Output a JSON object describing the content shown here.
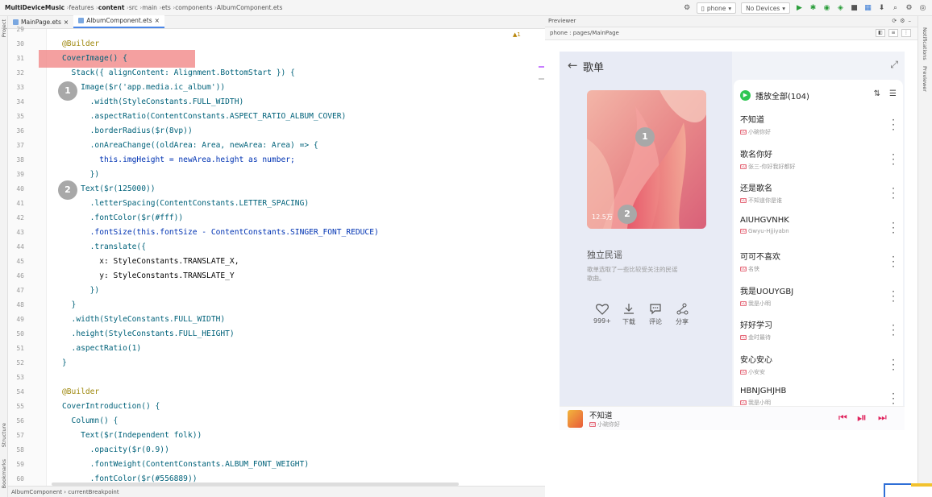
{
  "breadcrumb": [
    "MultiDeviceMusic",
    "features",
    "content",
    "src",
    "main",
    "ets",
    "components",
    "AlbumComponent.ets"
  ],
  "toolbar": {
    "device": "phone",
    "no_devices": "No Devices"
  },
  "tabs": [
    {
      "label": "MainPage.ets",
      "active": false
    },
    {
      "label": "AlbumComponent.ets",
      "active": true
    }
  ],
  "left_strip": {
    "project": "Project",
    "structure": "Structure",
    "bookmarks": "Bookmarks"
  },
  "editor": {
    "warnings": "▲1",
    "lines": [
      {
        "n": "29",
        "text": ""
      },
      {
        "n": "30",
        "text": "@Builder"
      },
      {
        "n": "31",
        "text": "CoverImage() {"
      },
      {
        "n": "32",
        "text": "  Stack({ alignContent: Alignment.BottomStart }) {"
      },
      {
        "n": "33",
        "text": "    Image($r('app.media.ic_album'))"
      },
      {
        "n": "34",
        "text": "      .width(StyleConstants.FULL_WIDTH)"
      },
      {
        "n": "35",
        "text": "      .aspectRatio(ContentConstants.ASPECT_RATIO_ALBUM_COVER)"
      },
      {
        "n": "36",
        "text": "      .borderRadius($r(8vp))"
      },
      {
        "n": "37",
        "text": "      .onAreaChange((oldArea: Area, newArea: Area) => {"
      },
      {
        "n": "38",
        "text": "        this.imgHeight = newArea.height as number;"
      },
      {
        "n": "39",
        "text": "      })"
      },
      {
        "n": "40",
        "text": "    Text($r(125000))"
      },
      {
        "n": "41",
        "text": "      .letterSpacing(ContentConstants.LETTER_SPACING)"
      },
      {
        "n": "42",
        "text": "      .fontColor($r(#fff))"
      },
      {
        "n": "43",
        "text": "      .fontSize(this.fontSize - ContentConstants.SINGER_FONT_REDUCE)"
      },
      {
        "n": "44",
        "text": "      .translate({"
      },
      {
        "n": "45",
        "text": "        x: StyleConstants.TRANSLATE_X,"
      },
      {
        "n": "46",
        "text": "        y: StyleConstants.TRANSLATE_Y"
      },
      {
        "n": "47",
        "text": "      })"
      },
      {
        "n": "48",
        "text": "  }"
      },
      {
        "n": "49",
        "text": "  .width(StyleConstants.FULL_WIDTH)"
      },
      {
        "n": "50",
        "text": "  .height(StyleConstants.FULL_HEIGHT)"
      },
      {
        "n": "51",
        "text": "  .aspectRatio(1)"
      },
      {
        "n": "52",
        "text": "}"
      },
      {
        "n": "53",
        "text": ""
      },
      {
        "n": "54",
        "text": "@Builder"
      },
      {
        "n": "55",
        "text": "CoverIntroduction() {"
      },
      {
        "n": "56",
        "text": "  Column() {"
      },
      {
        "n": "57",
        "text": "    Text($r(Independent folk))"
      },
      {
        "n": "58",
        "text": "      .opacity($r(0.9))"
      },
      {
        "n": "59",
        "text": "      .fontWeight(ContentConstants.ALBUM_FONT_WEIGHT)"
      },
      {
        "n": "60",
        "text": "      .fontColor($r(#556889))"
      }
    ],
    "badges": [
      "1",
      "2"
    ]
  },
  "statusbar": {
    "path": "AlbumComponent › currentBreakpoint"
  },
  "previewer": {
    "title": "Previewer",
    "path": "phone : pages/MainPage"
  },
  "right_strip": {
    "notifications": "Notifications",
    "previewer": "Previewer"
  },
  "app": {
    "title": "歌单",
    "play_count": "12.5万",
    "album_name": "独立民谣",
    "album_desc": "歌单选取了一些比较受关注的民谣歌曲。",
    "badges": [
      "1",
      "2"
    ],
    "actions": [
      {
        "label": "999+",
        "icon": "heart-icon"
      },
      {
        "label": "下载",
        "icon": "download-icon"
      },
      {
        "label": "评论",
        "icon": "comment-icon"
      },
      {
        "label": "分享",
        "icon": "share-icon"
      }
    ],
    "play_all": "播放全部(104)",
    "songs": [
      {
        "title": "不知道",
        "singer": "小碗你好"
      },
      {
        "title": "歌名你好",
        "singer": "张三-你好我好都好"
      },
      {
        "title": "还是歌名",
        "singer": "不知道你是谁"
      },
      {
        "title": "AIUHGVNHK",
        "singer": "Gwyu-Hjjiyabn"
      },
      {
        "title": "可可不喜欢",
        "singer": "名侠"
      },
      {
        "title": "我是UOUYGBJ",
        "singer": "我是小明"
      },
      {
        "title": "好好学习",
        "singer": "金时最待"
      },
      {
        "title": "安心安心",
        "singer": "小安安"
      },
      {
        "title": "HBNJGHJHB",
        "singer": "我是小明"
      }
    ],
    "player": {
      "title": "不知道",
      "singer": "小碗你好"
    },
    "accent": "#e0245e"
  }
}
